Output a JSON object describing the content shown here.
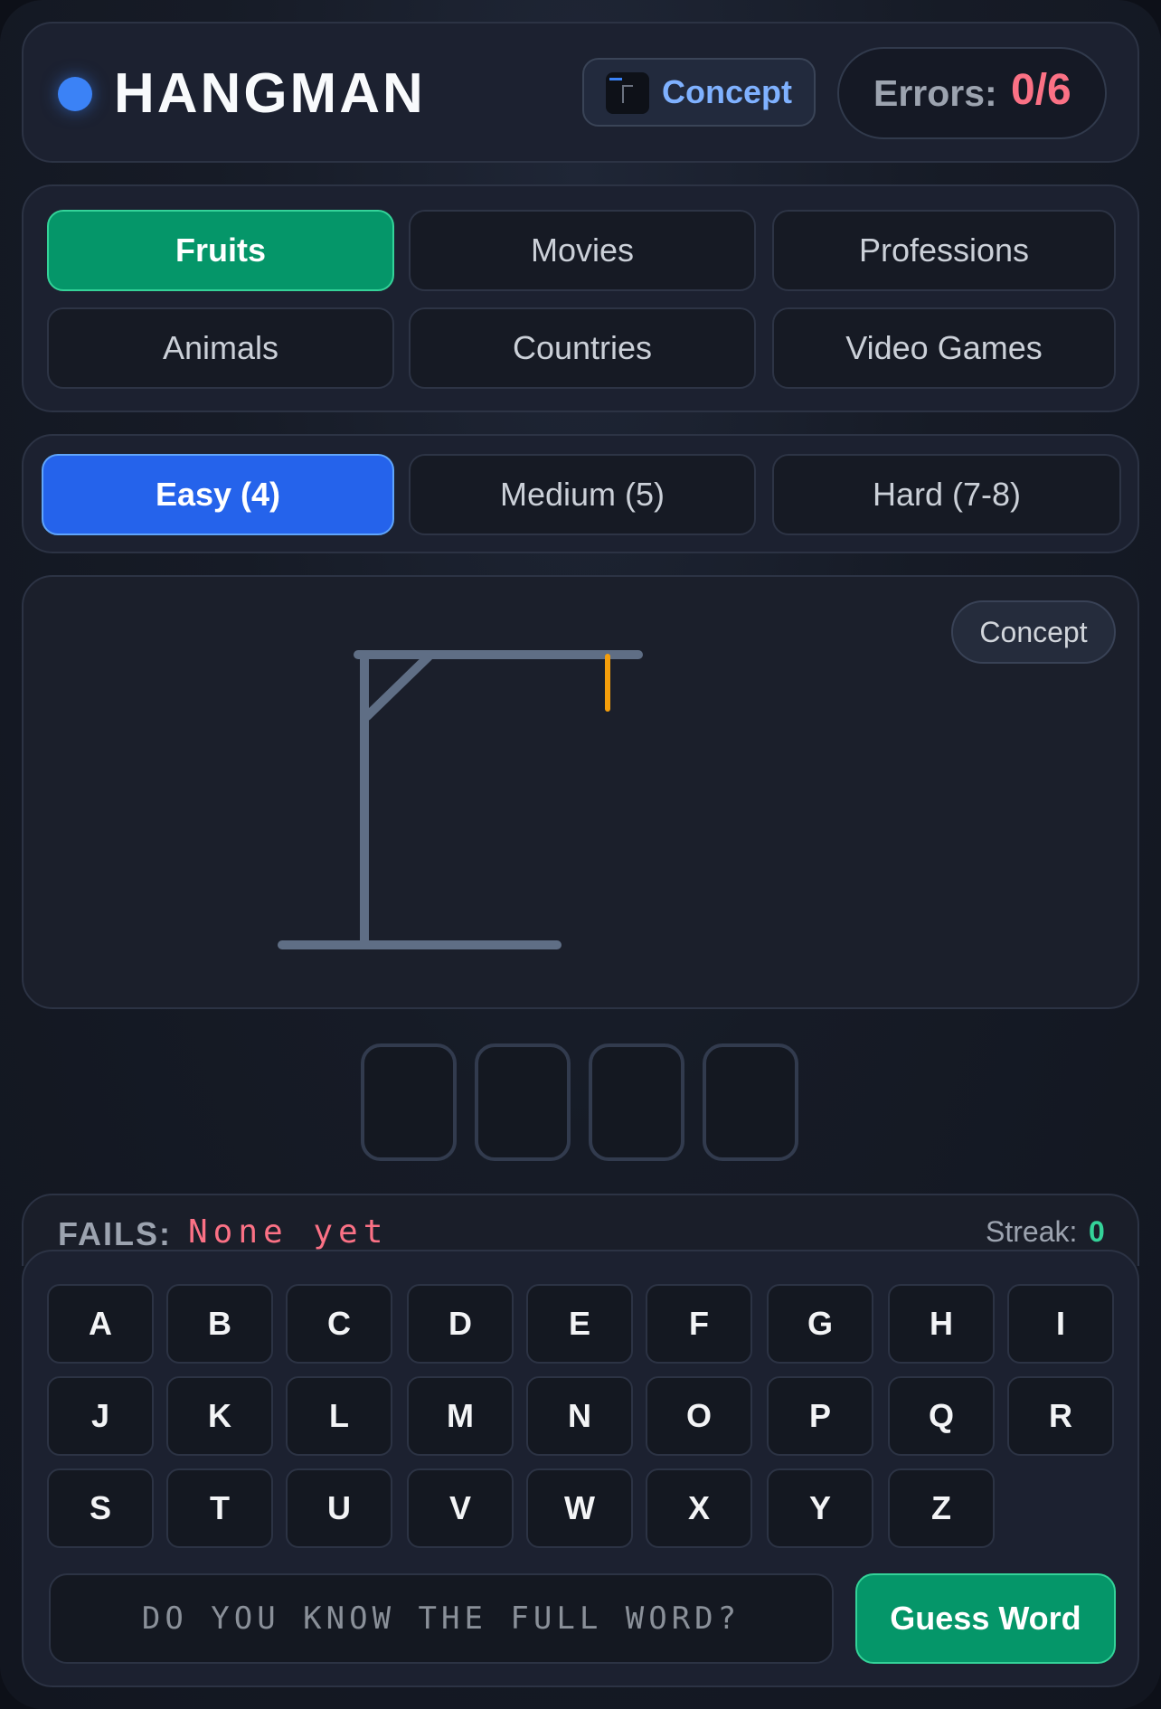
{
  "header": {
    "title": "HANGMAN",
    "concept_label": "Concept",
    "errors_label": "Errors:",
    "errors_value": "0/6"
  },
  "categories": [
    {
      "label": "Fruits",
      "selected": true
    },
    {
      "label": "Movies",
      "selected": false
    },
    {
      "label": "Professions",
      "selected": false
    },
    {
      "label": "Animals",
      "selected": false
    },
    {
      "label": "Countries",
      "selected": false
    },
    {
      "label": "Video Games",
      "selected": false
    }
  ],
  "difficulties": [
    {
      "label": "Easy (4)",
      "selected": true
    },
    {
      "label": "Medium (5)",
      "selected": false
    },
    {
      "label": "Hard (7-8)",
      "selected": false
    }
  ],
  "gallows": {
    "concept_label": "Concept"
  },
  "word": {
    "letters": [
      "",
      "",
      "",
      ""
    ]
  },
  "status": {
    "fails_label": "FAILS:",
    "fails_value": "None yet",
    "streak_label": "Streak:",
    "streak_value": "0"
  },
  "keyboard": {
    "rows": [
      [
        "A",
        "B",
        "C",
        "D",
        "E",
        "F",
        "G",
        "H",
        "I"
      ],
      [
        "J",
        "K",
        "L",
        "M",
        "N",
        "O",
        "P",
        "Q",
        "R"
      ],
      [
        "S",
        "T",
        "U",
        "V",
        "W",
        "X",
        "Y",
        "Z"
      ]
    ]
  },
  "guess": {
    "placeholder": "DO YOU KNOW THE FULL WORD?",
    "button_label": "Guess Word"
  },
  "colors": {
    "accent_blue": "#2563eb",
    "accent_green": "#059669",
    "error_red": "#fb7185",
    "rope_orange": "#f59e0b"
  }
}
